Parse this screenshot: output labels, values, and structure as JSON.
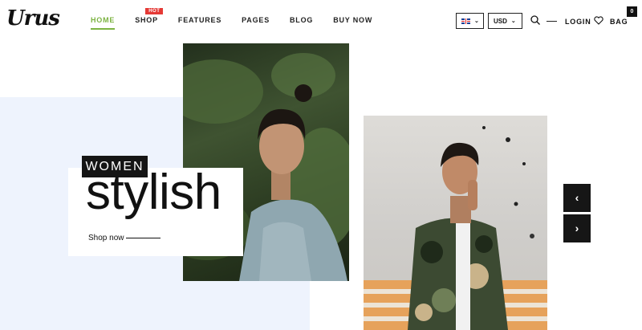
{
  "brand": {
    "logo": "Urus"
  },
  "nav": {
    "items": [
      {
        "label": "HOME",
        "active": true
      },
      {
        "label": "SHOP",
        "badge": "HOT"
      },
      {
        "label": "FEATURES"
      },
      {
        "label": "PAGES"
      },
      {
        "label": "BLOG"
      },
      {
        "label": "BUY NOW"
      }
    ]
  },
  "header": {
    "language": {
      "icon": "uk-flag-icon",
      "chevron": "chevron-down-icon"
    },
    "currency": {
      "value": "USD",
      "chevron": "chevron-down-icon"
    },
    "search_icon": "search-icon",
    "login_label": "LOGIN",
    "wishlist_icon": "heart-icon",
    "bag_label": "BAG",
    "bag_count": "0"
  },
  "hero": {
    "tag": "WOMEN",
    "headline": "stylish",
    "cta": "Shop now",
    "prev_icon": "chevron-left-icon",
    "next_icon": "chevron-right-icon"
  },
  "colors": {
    "accent": "#7cb342",
    "badge": "#e53935",
    "dark": "#151515",
    "hero_bg": "#eef3fd"
  }
}
